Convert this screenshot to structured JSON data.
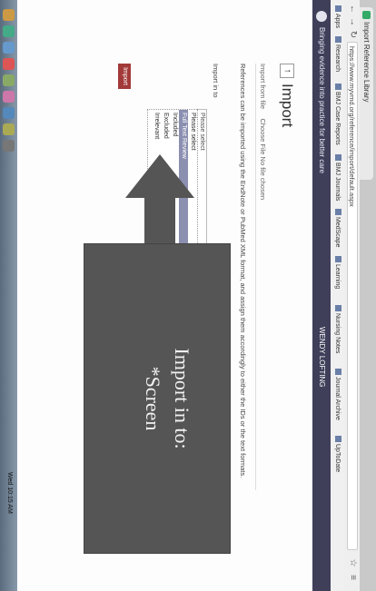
{
  "browser": {
    "tab_title": "Import Reference Library",
    "url": "https://www.myvmd.org/reference/import/default.aspx",
    "bookmarks": [
      "Apps",
      "Research",
      "BMJ Case Reports",
      "BMJ Journals",
      "MedScape",
      "Learning",
      "Nursing Notes",
      "Journal Archive",
      "UpToDate"
    ]
  },
  "app": {
    "tagline": "Bringing evidence into practice for better care",
    "user": "WENDY LOFTING"
  },
  "page": {
    "back_icon": "arrow-up-icon",
    "title": "Import",
    "import_file_label": "Import from file",
    "import_file_value": "Choose File  No file chosen",
    "info_text": "References can be imported using the EndNote or PubMed XML format, and assign them accordingly to either the IDs or the text formats.",
    "import_to_label": "Import in to",
    "select_value": "Please select",
    "options": [
      "Please select",
      "Full Text Review",
      "Included",
      "Excluded",
      "Irrelevant"
    ],
    "selected_option": "Full Text Review",
    "import_button": "Import"
  },
  "annotation": {
    "title": "Import in to:",
    "subtitle": "*Screen",
    "color": "#555555"
  },
  "dock": {
    "status": "Wed 10:15 AM"
  }
}
